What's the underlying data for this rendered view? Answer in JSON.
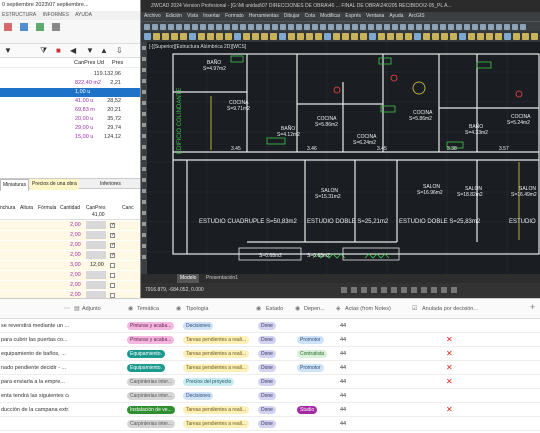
{
  "left_window": {
    "title": "0 septiembre 2023\\07 septiembre...",
    "menu": [
      "ESTRUCTURA",
      "INFORMES",
      "AYUDA"
    ],
    "columns": {
      "canpres_ud": "CanPres Ud",
      "pres": "Pres"
    },
    "rows": [
      {
        "canpres": "",
        "pres": "119.132,96"
      },
      {
        "canpres": "822,40 m2",
        "pres": "2,21"
      },
      {
        "canpres": "1,00 u",
        "pres": ""
      },
      {
        "canpres": "41,00 u",
        "pres": "28,52"
      },
      {
        "canpres": "69,83 m",
        "pres": "20,21"
      },
      {
        "canpres": "20,00 u",
        "pres": "35,72"
      },
      {
        "canpres": "29,00 u",
        "pres": "29,74"
      },
      {
        "canpres": "15,00 u",
        "pres": "124,12"
      }
    ],
    "tabs": [
      "Miniaturas",
      "Precios de una obra",
      "Inferiores"
    ],
    "grid_headers": [
      "nchura",
      "Altura",
      "Fórmula",
      "Cantidad",
      "CanPres",
      "Canc"
    ],
    "grid_sub": "41,00",
    "grid_rows": [
      {
        "val": "2,00",
        "extra": ""
      },
      {
        "val": "2,00",
        "extra": ""
      },
      {
        "val": "2,00",
        "extra": ""
      },
      {
        "val": "2,00",
        "extra": ""
      },
      {
        "val": "3,00",
        "extra": "12,00"
      },
      {
        "val": "2,00",
        "extra": ""
      },
      {
        "val": "2,00",
        "extra": ""
      },
      {
        "val": "2,00",
        "extra": ""
      }
    ]
  },
  "cad": {
    "title": "ZWCAD 2024 Version Profesional - [G:\\Mi unidad\\07 DIRECCIONES DE OBRA\\46 ... FINAL DE OBRA\\240205 RECIBIDO\\2-05_PL A...",
    "menu": [
      "Archivo",
      "Edición",
      "Vista",
      "Insertar",
      "Formato",
      "Herramientas",
      "Dibujar",
      "Cota",
      "Modificar",
      "Exprés",
      "Ventana",
      "Ayuda",
      "ArcGIS"
    ],
    "view_label": "[-][Superior][Estructura Alámbrica 2D][WCS]",
    "labels": {
      "bano_a": "BAÑO",
      "bano_a_s": "S=4.97m2",
      "bano_b": "BAÑO",
      "bano_b_s": "S=4.12m2",
      "bano_c": "BAÑO",
      "bano_c_s": "S=4.33m2",
      "cocina_a": "COCINA",
      "cocina_a_s": "S=9.71m2",
      "cocina_b": "COCINA",
      "cocina_b_s": "S=5.86m2",
      "cocina_c": "COCINA",
      "cocina_c_s": "S=6.24m2",
      "cocina_d": "COCINA",
      "cocina_d_s": "S=5.86m2",
      "cocina_e": "COCINA",
      "cocina_e_s": "S=5.24m2",
      "salon_a": "SALON",
      "salon_a_s": "S=15.31m2",
      "salon_b": "SALON",
      "salon_b_s": "S=16.96m2",
      "salon_c": "SALON",
      "salon_c_s": "S=18.82m2",
      "salon_d": "SALON",
      "salon_d_s": "S=16.49m2",
      "edificio": "EDIFICIO COLINDANTE",
      "estudio_cuadruple": "ESTUDIO CUADRUPLE S=50,83m2",
      "estudio_doble_a": "ESTUDIO DOBLE S=25,21m2",
      "estudio_doble_b": "ESTUDIO DOBLE S=25,83m2",
      "estudio_e": "ESTUDIO",
      "s_bottom_a": "S=0.68m2",
      "s_bottom_b": "S=0.68m2",
      "dim_a": "3.45",
      "dim_b": "3.46",
      "dim_c": "3.45",
      "dim_d": "3.38",
      "dim_e": "3.57"
    },
    "tabs": [
      "Modelo",
      "Presentación1"
    ],
    "coords": "7916.879, -684.052, 0.000"
  },
  "table": {
    "headers": {
      "adjunto": "Adjunto",
      "tematica": "Temática",
      "tipologia": "Tipología",
      "estado": "Estado",
      "depen": "Depen...",
      "actas": "Actas (from Notes)",
      "anulada": "Anulada por decisión..."
    },
    "rows": [
      {
        "desc": "se reverstirá mediante un ...",
        "tema": "Pinturas y acaba...",
        "tipo": "Decisiones",
        "estado": "Done",
        "dep": "",
        "num": "44",
        "x": false
      },
      {
        "desc": "para cubrir las puertas co...",
        "tema": "Pinturas y acaba...",
        "tipo": "Tareas pendientes a reali...",
        "estado": "Done",
        "dep": "Promotor",
        "num": "44",
        "x": true
      },
      {
        "desc": "equipamiento de baños, ...",
        "tema": "Equipamiento.",
        "tipo": "Tareas pendientes a reali...",
        "estado": "Done",
        "dep": "Contratista",
        "num": "44",
        "x": true
      },
      {
        "desc": "nado pendiente decidir - ...",
        "tema": "Equipamiento.",
        "tipo": "Tareas pendientes a reali...",
        "estado": "Done",
        "dep": "Promotor",
        "num": "44",
        "x": true
      },
      {
        "desc": "para enviarla a la empre...",
        "tema": "Carpinterias inter...",
        "tipo": "Precios del proyecto",
        "estado": "Done",
        "dep": "",
        "num": "44",
        "x": true
      },
      {
        "desc": "enta tendrá las siguientes ca...",
        "tema": "Carpinterias inter...",
        "tipo": "Decisiones",
        "estado": "Done",
        "dep": "",
        "num": "44",
        "x": false
      },
      {
        "desc": "ducción de la campana extr...",
        "tema": "Instalación de ve...",
        "tipo": "Tareas pendientes a reali...",
        "estado": "Done",
        "dep": "Studio",
        "num": "44",
        "x": true
      },
      {
        "desc": "",
        "tema": "Carpinterias inter...",
        "tipo": "Tareas pendientes a reali...",
        "estado": "Done",
        "dep": "",
        "num": "44",
        "x": false
      }
    ]
  }
}
